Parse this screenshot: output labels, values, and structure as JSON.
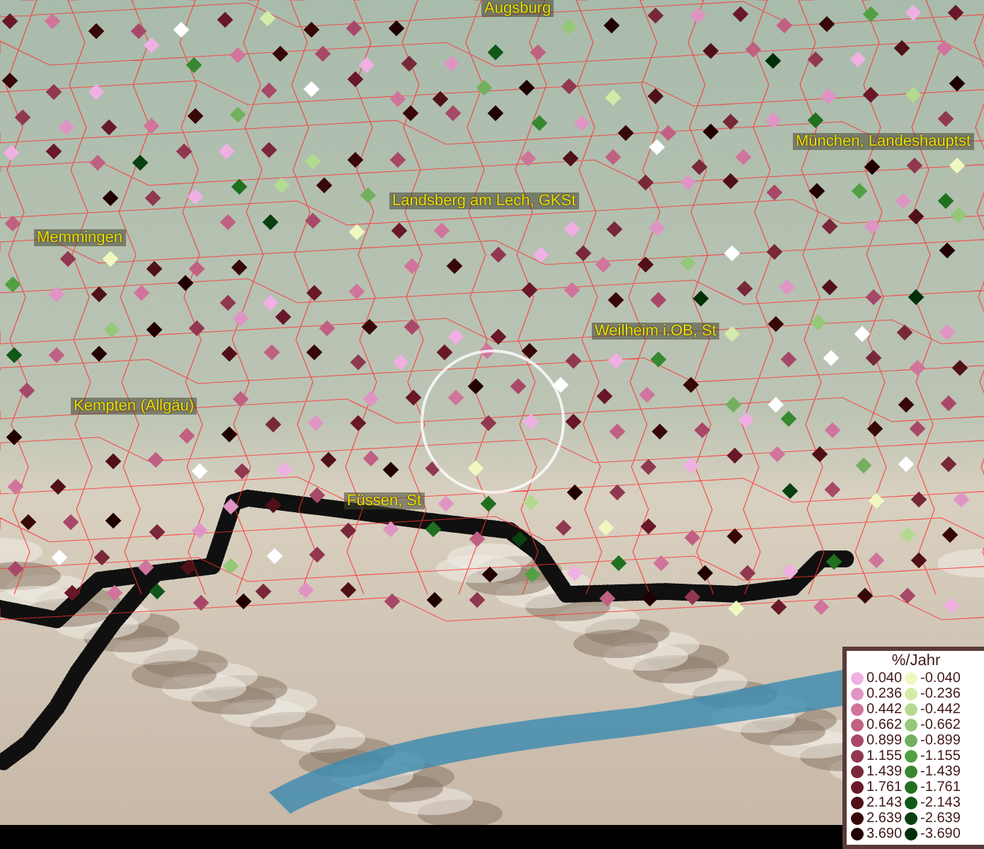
{
  "map": {
    "places": [
      {
        "name": "Augsburg"
      },
      {
        "name": "München, Landeshauptst"
      },
      {
        "name": "Landsberg am Lech, GKSt"
      },
      {
        "name": "Memmingen"
      },
      {
        "name": "Weilheim i.OB, St"
      },
      {
        "name": "Kempten (Allgäu)"
      },
      {
        "name": "Füssen, St"
      }
    ]
  },
  "legend": {
    "title": "%/Jahr",
    "rows": [
      {
        "positive": {
          "value": "0.040",
          "color": "#f0b0e4"
        },
        "negative": {
          "value": "-0.040",
          "color": "#f0f8c0"
        }
      },
      {
        "positive": {
          "value": "0.236",
          "color": "#e094c4"
        },
        "negative": {
          "value": "-0.236",
          "color": "#d4eaa8"
        }
      },
      {
        "positive": {
          "value": "0.442",
          "color": "#d0749c"
        },
        "negative": {
          "value": "-0.442",
          "color": "#b4da90"
        }
      },
      {
        "positive": {
          "value": "0.662",
          "color": "#c06082"
        },
        "negative": {
          "value": "-0.662",
          "color": "#94c878"
        }
      },
      {
        "positive": {
          "value": "0.899",
          "color": "#a84868"
        },
        "negative": {
          "value": "-0.899",
          "color": "#72b060"
        }
      },
      {
        "positive": {
          "value": "1.155",
          "color": "#903850"
        },
        "negative": {
          "value": "-1.155",
          "color": "#52a042"
        }
      },
      {
        "positive": {
          "value": "1.439",
          "color": "#782838"
        },
        "negative": {
          "value": "-1.439",
          "color": "#388830"
        }
      },
      {
        "positive": {
          "value": "1.761",
          "color": "#681828"
        },
        "negative": {
          "value": "-1.761",
          "color": "#207020"
        }
      },
      {
        "positive": {
          "value": "2.143",
          "color": "#501018"
        },
        "negative": {
          "value": "-2.143",
          "color": "#105818"
        }
      },
      {
        "positive": {
          "value": "2.639",
          "color": "#380808"
        },
        "negative": {
          "value": "-2.639",
          "color": "#084010"
        }
      },
      {
        "positive": {
          "value": "3.690",
          "color": "#200000"
        },
        "negative": {
          "value": "-3.690",
          "color": "#003008"
        }
      }
    ]
  }
}
